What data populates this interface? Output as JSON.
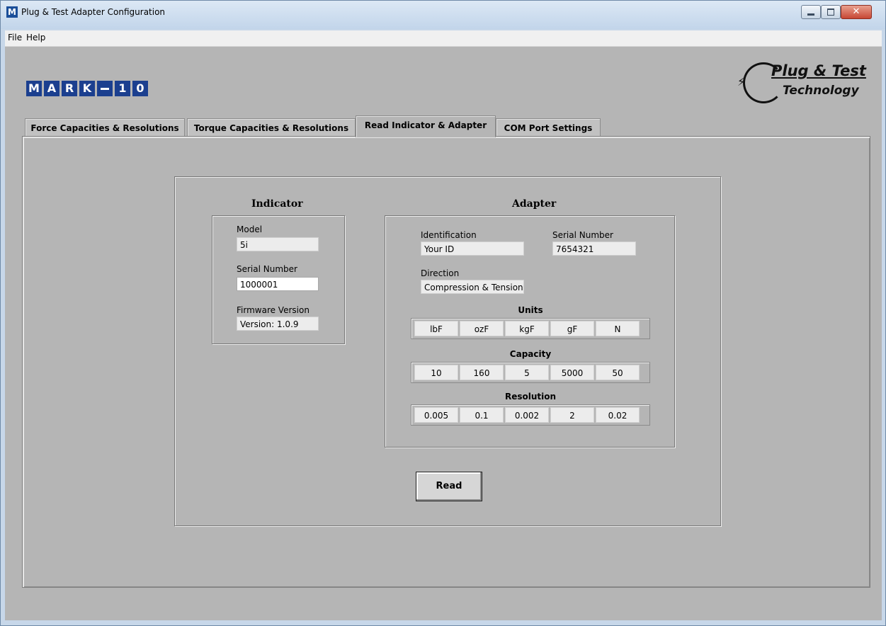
{
  "window": {
    "app_icon_letter": "M",
    "title": "Plug & Test Adapter Configuration",
    "close_glyph": "✕"
  },
  "menu": {
    "items": [
      {
        "label": "File"
      },
      {
        "label": "Help"
      }
    ]
  },
  "branding": {
    "left_logo_chars": [
      "M",
      "A",
      "R",
      "K",
      "-",
      "1",
      "0"
    ],
    "right_logo_line1": "Plug & Test",
    "right_logo_line2": "Technology"
  },
  "tabs": [
    {
      "label": "Force Capacities & Resolutions",
      "active": false
    },
    {
      "label": "Torque Capacities & Resolutions",
      "active": false
    },
    {
      "label": "Read Indicator & Adapter",
      "active": true
    },
    {
      "label": "COM Port Settings",
      "active": false
    }
  ],
  "indicator": {
    "title": "Indicator",
    "model_label": "Model",
    "model_value": "5i",
    "serial_label": "Serial Number",
    "serial_value": "1000001",
    "firmware_label": "Firmware Version",
    "firmware_value": "Version: 1.0.9"
  },
  "adapter": {
    "title": "Adapter",
    "identification_label": "Identification",
    "identification_value": "Your ID",
    "serial_label": "Serial Number",
    "serial_value": "7654321",
    "direction_label": "Direction",
    "direction_value": "Compression & Tension",
    "units_title": "Units",
    "units": [
      "lbF",
      "ozF",
      "kgF",
      "gF",
      "N"
    ],
    "capacity_title": "Capacity",
    "capacity": [
      "10",
      "160",
      "5",
      "5000",
      "50"
    ],
    "resolution_title": "Resolution",
    "resolution": [
      "0.005",
      "0.1",
      "0.002",
      "2",
      "0.02"
    ]
  },
  "actions": {
    "read_label": "Read"
  }
}
